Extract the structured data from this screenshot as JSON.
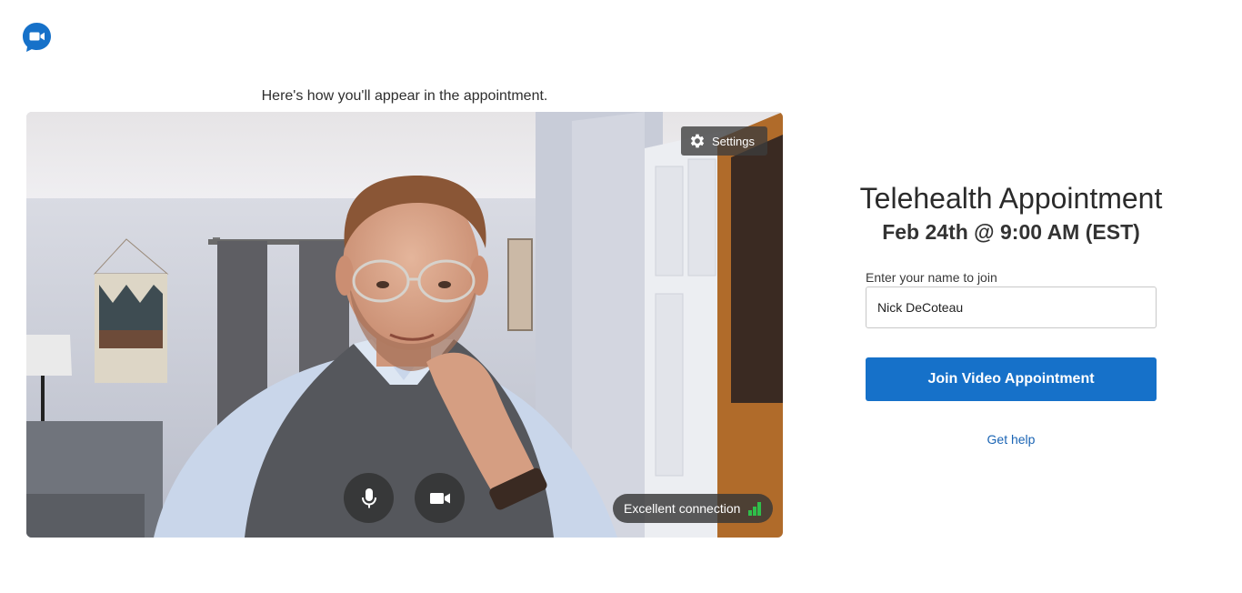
{
  "app": {
    "logo_icon": "video-chat-bubble-icon",
    "brand_color": "#1671c9"
  },
  "preview": {
    "caption": "Here's how you'll appear in the appointment.",
    "settings_label": "Settings",
    "settings_icon": "gear-icon",
    "mic_icon": "microphone-icon",
    "camera_icon": "video-camera-icon",
    "connection_status": "Excellent connection",
    "connection_icon": "signal-bars-icon",
    "connection_color": "#2fbf4a"
  },
  "appointment": {
    "title": "Telehealth Appointment",
    "datetime": "Feb 24th @ 9:00 AM (EST)"
  },
  "join_form": {
    "name_label": "Enter your name to join",
    "name_value": "Nick DeCoteau",
    "join_label": "Join Video Appointment",
    "help_link": "Get help"
  }
}
